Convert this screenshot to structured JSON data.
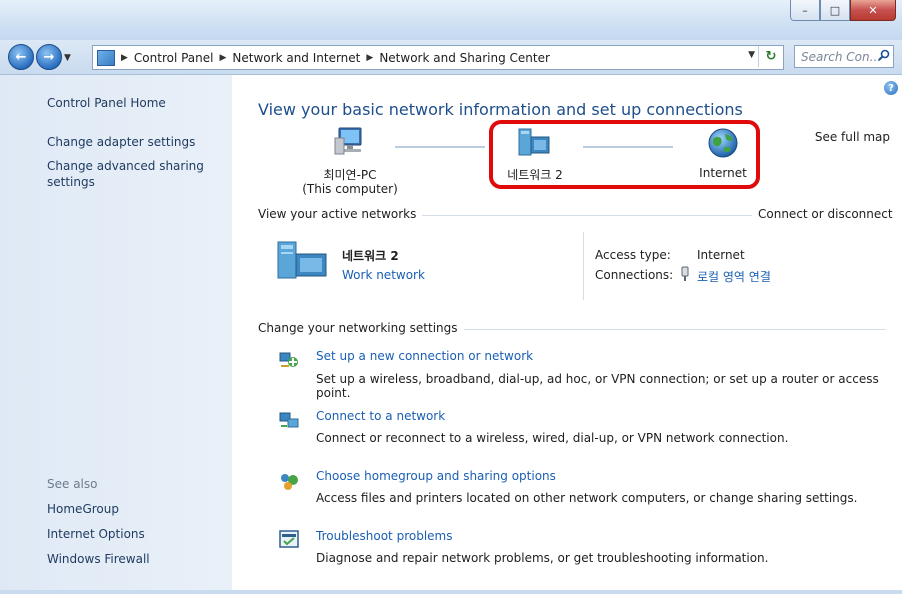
{
  "window": {
    "caption_buttons": {
      "minimize": "–",
      "maximize": "□",
      "close": "✕"
    }
  },
  "nav": {
    "back_icon": "←",
    "forward_icon": "→",
    "breadcrumb": [
      "Control Panel",
      "Network and Internet",
      "Network and Sharing Center"
    ],
    "search_placeholder": "Search Con...",
    "refresh_icon": "↻"
  },
  "sidebar": {
    "home": "Control Panel Home",
    "links": [
      "Change adapter settings",
      "Change advanced sharing settings"
    ],
    "see_also_title": "See also",
    "see_also": [
      "HomeGroup",
      "Internet Options",
      "Windows Firewall"
    ]
  },
  "main": {
    "heading": "View your basic network information and set up connections",
    "see_full_map": "See full map",
    "map": {
      "computer_name": "최미연-PC",
      "computer_sub": "(This computer)",
      "network_name": "네트워크 2",
      "internet": "Internet"
    },
    "active_networks": {
      "title": "View your active networks",
      "connect_link": "Connect or disconnect",
      "network_name": "네트워크 2",
      "network_type": "Work network",
      "access_label": "Access type:",
      "access_value": "Internet",
      "connections_label": "Connections:",
      "connections_value": "로컬 영역 연결"
    },
    "settings": {
      "title": "Change your networking settings",
      "tasks": [
        {
          "title": "Set up a new connection or network",
          "desc": "Set up a wireless, broadband, dial-up, ad hoc, or VPN connection; or set up a router or access point."
        },
        {
          "title": "Connect to a network",
          "desc": "Connect or reconnect to a wireless, wired, dial-up, or VPN network connection."
        },
        {
          "title": "Choose homegroup and sharing options",
          "desc": "Access files and printers located on other network computers, or change sharing settings."
        },
        {
          "title": "Troubleshoot problems",
          "desc": "Diagnose and repair network problems, or get troubleshooting information."
        }
      ]
    }
  },
  "colors": {
    "link": "#1a5fb4",
    "heading": "#1e4e8c",
    "highlight": "#e00a0a"
  }
}
